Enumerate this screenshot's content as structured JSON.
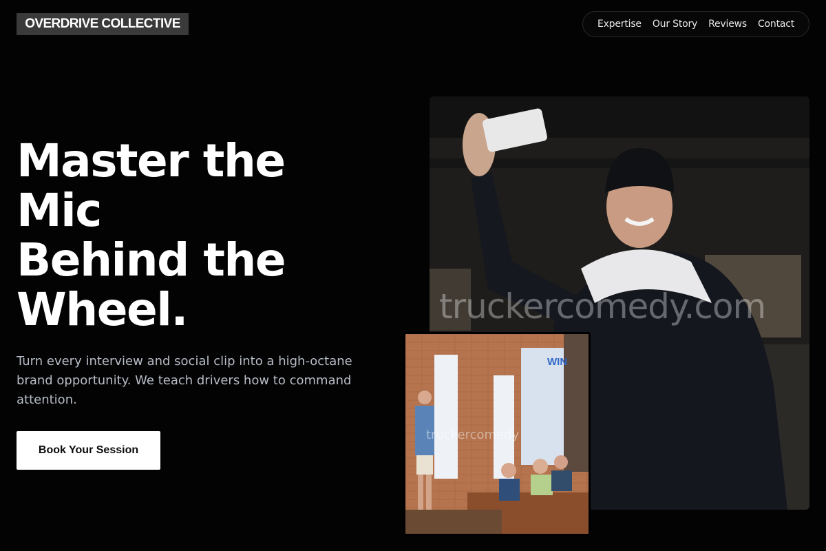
{
  "brand": {
    "name": "OVERDRIVE COLLECTIVE"
  },
  "nav": {
    "items": [
      "Expertise",
      "Our Story",
      "Reviews",
      "Contact"
    ]
  },
  "hero": {
    "headline_lines": [
      "Master the",
      "Mic",
      "Behind the",
      "Wheel."
    ],
    "subtext": "Turn every interview and social clip into a high-octane brand opportunity. We teach drivers how to command attention.",
    "cta_label": "Book Your Session"
  },
  "images": {
    "main": {
      "watermark": "truckercomedy.com"
    },
    "inset": {
      "watermark": "truckercomedy",
      "wall_sign": "WIN"
    }
  },
  "colors": {
    "background": "#030303",
    "logo_bg": "#3a3a3a",
    "nav_border": "#2a2a2a",
    "subtext": "#b7bcc6",
    "cta_bg": "#ffffff",
    "cta_text": "#0b0b0b"
  }
}
